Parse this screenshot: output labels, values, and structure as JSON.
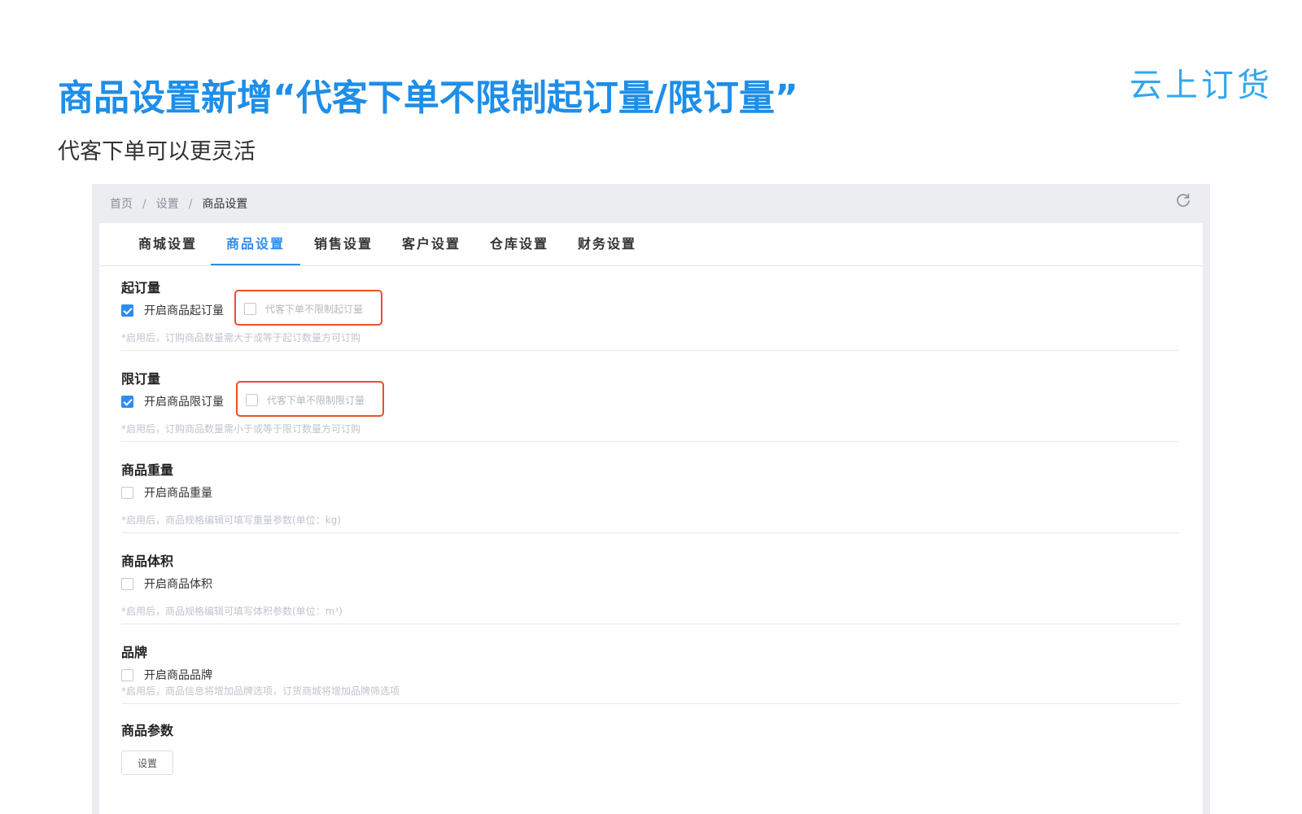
{
  "slide": {
    "title": "商品设置新增“代客下单不限制起订量/限订量”",
    "subtitle": "代客下单可以更灵活",
    "brand": "云上订货"
  },
  "colors": {
    "title_blue": "#1e8ee8",
    "accent": "#2d8cf0",
    "highlight_border": "#e8502a"
  },
  "breadcrumb": {
    "items": [
      "首页",
      "设置",
      "商品设置"
    ],
    "separator": "/"
  },
  "tabs": [
    {
      "label": "商城设置",
      "active": false
    },
    {
      "label": "商品设置",
      "active": true
    },
    {
      "label": "销售设置",
      "active": false
    },
    {
      "label": "客户设置",
      "active": false
    },
    {
      "label": "仓库设置",
      "active": false
    },
    {
      "label": "财务设置",
      "active": false
    }
  ],
  "sections": {
    "min_order": {
      "title": "起订量",
      "checkbox_label": "开启商品起订量",
      "checked": true,
      "sub_option_label": "代客下单不限制起订量",
      "sub_option_checked": false,
      "hint": "*启用后，订购商品数量需大于或等于起订数量方可订购"
    },
    "max_order": {
      "title": "限订量",
      "checkbox_label": "开启商品限订量",
      "checked": true,
      "sub_option_label": "代客下单不限制限订量",
      "sub_option_checked": false,
      "hint": "*启用后，订购商品数量需小于或等于限订数量方可订购"
    },
    "weight": {
      "title": "商品重量",
      "checkbox_label": "开启商品重量",
      "checked": false,
      "hint": "*启用后，商品规格编辑可填写重量参数(单位：kg)"
    },
    "volume": {
      "title": "商品体积",
      "checkbox_label": "开启商品体积",
      "checked": false,
      "hint": "*启用后，商品规格编辑可填写体积参数(单位：m³)"
    },
    "brand": {
      "title": "品牌",
      "checkbox_label": "开启商品品牌",
      "checked": false,
      "hint": "*启用后，商品信息将增加品牌选项，订货商城将增加品牌筛选项"
    },
    "params": {
      "title": "商品参数",
      "button_label": "设置"
    }
  },
  "icons": {
    "refresh": "refresh-icon",
    "check": "checkmark-icon"
  }
}
